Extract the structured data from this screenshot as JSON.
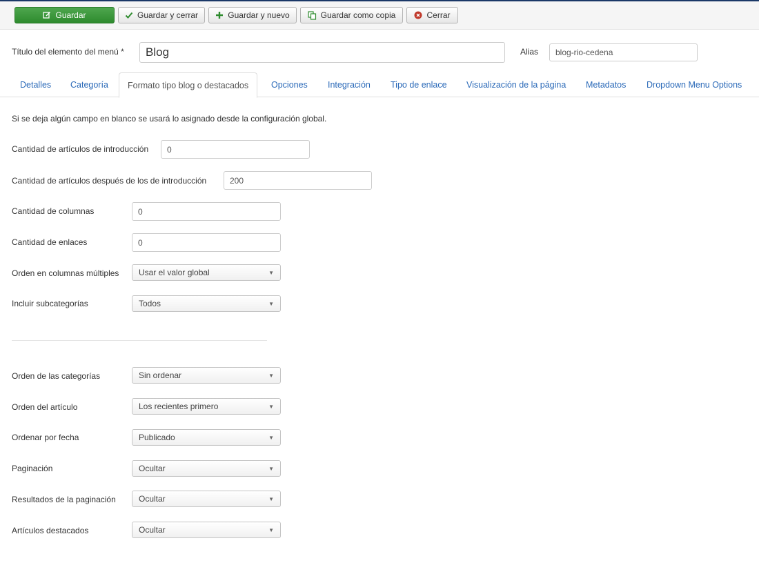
{
  "toolbar": {
    "save": "Guardar",
    "save_close": "Guardar y cerrar",
    "save_new": "Guardar y nuevo",
    "save_copy": "Guardar como copia",
    "close": "Cerrar"
  },
  "title_row": {
    "title_label": "Título del elemento del menú *",
    "title_value": "Blog",
    "alias_label": "Alias",
    "alias_value": "blog-rio-cedena"
  },
  "tabs": [
    {
      "label": "Detalles",
      "active": false
    },
    {
      "label": "Categoría",
      "active": false
    },
    {
      "label": "Formato tipo blog o destacados",
      "active": true
    },
    {
      "label": "Opciones",
      "active": false
    },
    {
      "label": "Integración",
      "active": false
    },
    {
      "label": "Tipo de enlace",
      "active": false
    },
    {
      "label": "Visualización de la página",
      "active": false
    },
    {
      "label": "Metadatos",
      "active": false
    },
    {
      "label": "Dropdown Menu Options",
      "active": false
    }
  ],
  "note": "Si se deja algún campo en blanco se usará lo asignado desde la configuración global.",
  "fields": {
    "intro_count": {
      "label": "Cantidad de artículos de introducción",
      "value": "0"
    },
    "after_intro_count": {
      "label": "Cantidad de artículos después de los de introducción",
      "value": "200"
    },
    "columns": {
      "label": "Cantidad de columnas",
      "value": "0"
    },
    "links": {
      "label": "Cantidad de enlaces",
      "value": "0"
    },
    "multi_column_order": {
      "label": "Orden en columnas múltiples",
      "value": "Usar el valor global"
    },
    "include_subcategories": {
      "label": "Incluir subcategorías",
      "value": "Todos"
    },
    "category_order": {
      "label": "Orden de las categorías",
      "value": "Sin ordenar"
    },
    "article_order": {
      "label": "Orden del artículo",
      "value": "Los recientes primero"
    },
    "date_order": {
      "label": "Ordenar por fecha",
      "value": "Publicado"
    },
    "pagination": {
      "label": "Paginación",
      "value": "Ocultar"
    },
    "pagination_results": {
      "label": "Resultados de la paginación",
      "value": "Ocultar"
    },
    "featured_articles": {
      "label": "Artículos destacados",
      "value": "Ocultar"
    }
  },
  "colors": {
    "primary_green": "#3c9a3c",
    "link_blue": "#2a69b8",
    "close_red": "#c0392b"
  }
}
